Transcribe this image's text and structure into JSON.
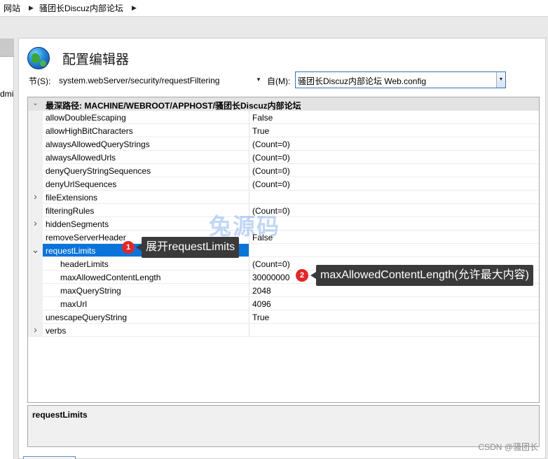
{
  "breadcrumb": [
    "网站",
    "骚团长Discuz内部论坛"
  ],
  "left_pane_cut_text": "dmi",
  "editor": {
    "title": "配置编辑器",
    "section_label": "节(S):",
    "section_value": "system.webServer/security/requestFiltering",
    "from_label": "自(M):",
    "from_value": "骚团长Discuz内部论坛 Web.config"
  },
  "grid": {
    "header": "最深路径: MACHINE/WEBROOT/APPHOST/骚团长Discuz内部论坛",
    "rows": [
      {
        "name": "allowDoubleEscaping",
        "value": "False",
        "expander": "",
        "level": 0
      },
      {
        "name": "allowHighBitCharacters",
        "value": "True",
        "expander": "",
        "level": 0
      },
      {
        "name": "alwaysAllowedQueryStrings",
        "value": "(Count=0)",
        "expander": "",
        "level": 0
      },
      {
        "name": "alwaysAllowedUrls",
        "value": "(Count=0)",
        "expander": "",
        "level": 0
      },
      {
        "name": "denyQueryStringSequences",
        "value": "(Count=0)",
        "expander": "",
        "level": 0
      },
      {
        "name": "denyUrlSequences",
        "value": "(Count=0)",
        "expander": "",
        "level": 0
      },
      {
        "name": "fileExtensions",
        "value": "",
        "expander": ">",
        "level": 0
      },
      {
        "name": "filteringRules",
        "value": "(Count=0)",
        "expander": "",
        "level": 0
      },
      {
        "name": "hiddenSegments",
        "value": "",
        "expander": ">",
        "level": 0
      },
      {
        "name": "removeServerHeader",
        "value": "False",
        "expander": "",
        "level": 0
      },
      {
        "name": "requestLimits",
        "value": "",
        "expander": "v",
        "level": 0,
        "selected": true
      },
      {
        "name": "headerLimits",
        "value": "(Count=0)",
        "expander": "",
        "level": 1
      },
      {
        "name": "maxAllowedContentLength",
        "value": "30000000",
        "expander": "",
        "level": 1
      },
      {
        "name": "maxQueryString",
        "value": "2048",
        "expander": "",
        "level": 1
      },
      {
        "name": "maxUrl",
        "value": "4096",
        "expander": "",
        "level": 1
      },
      {
        "name": "unescapeQueryString",
        "value": "True",
        "expander": "",
        "level": 0
      },
      {
        "name": "verbs",
        "value": "",
        "expander": ">",
        "level": 0
      }
    ]
  },
  "description": "requestLimits",
  "annotations": [
    {
      "badge": "1",
      "text": "展开requestLimits"
    },
    {
      "badge": "2",
      "text": "maxAllowedContentLength(允许最大内容)"
    }
  ],
  "watermark": "兔源码",
  "footer": "CSDN @骚团长",
  "icons": {
    "title": "globe-icon",
    "expander_collapsed": "chevron-right-icon",
    "expander_expanded": "chevron-down-icon"
  }
}
